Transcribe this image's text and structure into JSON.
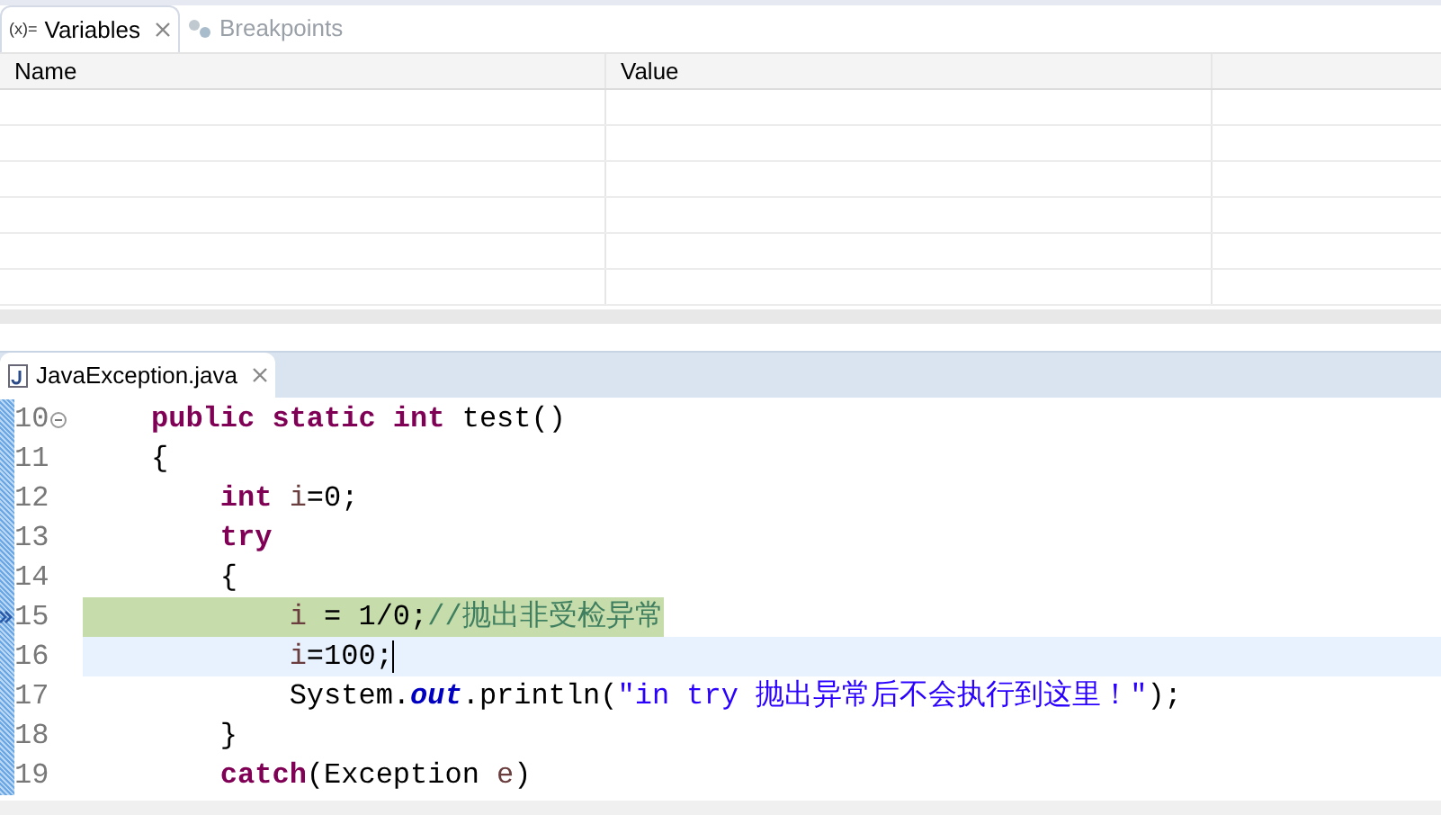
{
  "variables_view": {
    "tabs": [
      {
        "label": "Variables",
        "selected": true,
        "icon": "(x)="
      },
      {
        "label": "Breakpoints",
        "selected": false
      }
    ],
    "table": {
      "columns": [
        "Name",
        "Value"
      ]
    }
  },
  "editor": {
    "tab": {
      "title": "JavaException.java",
      "selected": true
    },
    "lines": [
      {
        "number": "10",
        "fold": true,
        "instruction_pointer": false,
        "caret_line": false,
        "tokens": [
          {
            "kind": "keyword",
            "text": "public static int"
          },
          {
            "kind": "plain",
            "text": " test()"
          }
        ]
      },
      {
        "number": "11",
        "fold": false,
        "instruction_pointer": false,
        "caret_line": false,
        "tokens": [
          {
            "kind": "plain",
            "text": "{"
          }
        ]
      },
      {
        "number": "12",
        "fold": false,
        "instruction_pointer": false,
        "caret_line": false,
        "tokens": [
          {
            "kind": "keyword",
            "text": "    int"
          },
          {
            "kind": "var",
            "text": " i"
          },
          {
            "kind": "plain",
            "text": "=0;"
          }
        ]
      },
      {
        "number": "13",
        "fold": false,
        "instruction_pointer": false,
        "caret_line": false,
        "tokens": [
          {
            "kind": "keyword",
            "text": "    try"
          }
        ]
      },
      {
        "number": "14",
        "fold": false,
        "instruction_pointer": false,
        "caret_line": false,
        "tokens": [
          {
            "kind": "plain",
            "text": "    {"
          }
        ]
      },
      {
        "number": "15",
        "fold": false,
        "instruction_pointer": true,
        "caret_line": false,
        "tokens": [
          {
            "kind": "var",
            "text": "        i"
          },
          {
            "kind": "plain",
            "text": " = 1/0;"
          },
          {
            "kind": "comment",
            "text": "//抛出非受检异常"
          }
        ]
      },
      {
        "number": "16",
        "fold": false,
        "instruction_pointer": false,
        "caret_line": true,
        "tokens": [
          {
            "kind": "var",
            "text": "        i"
          },
          {
            "kind": "plain",
            "text": "=100;"
          }
        ]
      },
      {
        "number": "17",
        "fold": false,
        "instruction_pointer": false,
        "caret_line": false,
        "tokens": [
          {
            "kind": "plain",
            "text": "        System."
          },
          {
            "kind": "field",
            "text": "out"
          },
          {
            "kind": "plain",
            "text": ".println("
          },
          {
            "kind": "string",
            "text": "\"in try 抛出异常后不会执行到这里！\""
          },
          {
            "kind": "plain",
            "text": ");"
          }
        ]
      },
      {
        "number": "18",
        "fold": false,
        "instruction_pointer": false,
        "caret_line": false,
        "tokens": [
          {
            "kind": "plain",
            "text": "    }"
          }
        ]
      },
      {
        "number": "19",
        "fold": false,
        "instruction_pointer": false,
        "caret_line": false,
        "tokens": [
          {
            "kind": "keyword",
            "text": "    catch"
          },
          {
            "kind": "plain",
            "text": "(Exception"
          },
          {
            "kind": "var",
            "text": " e"
          },
          {
            "kind": "plain",
            "text": ")"
          }
        ]
      }
    ]
  }
}
